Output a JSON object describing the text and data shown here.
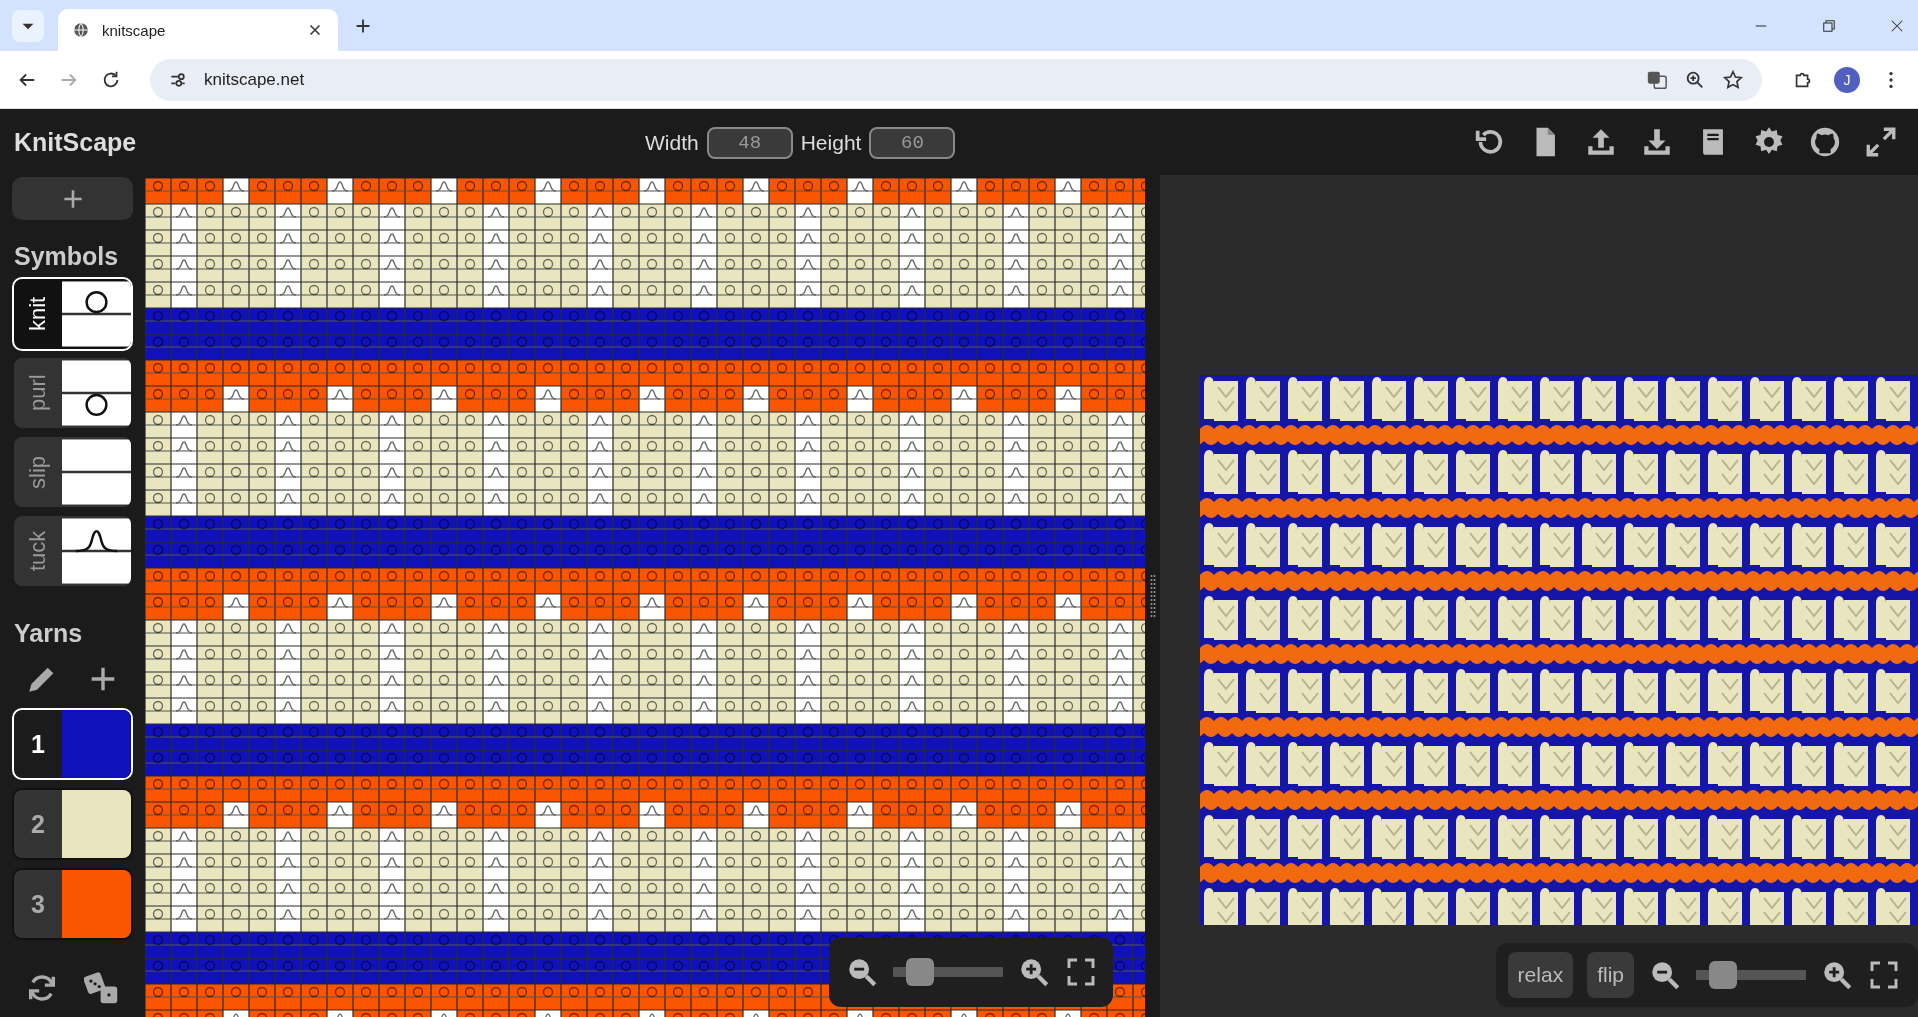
{
  "browser": {
    "tab_title": "knitscape",
    "url": "knitscape.net",
    "profile_initial": "J"
  },
  "header": {
    "title": "KnitScape",
    "width_label": "Width",
    "width_value": "48",
    "height_label": "Height",
    "height_value": "60"
  },
  "symbols_heading": "Symbols",
  "symbols": [
    {
      "label": "knit",
      "kind": "knit",
      "selected": true
    },
    {
      "label": "purl",
      "kind": "purl",
      "selected": false
    },
    {
      "label": "slip",
      "kind": "slip",
      "selected": false
    },
    {
      "label": "tuck",
      "kind": "tuck",
      "selected": false
    }
  ],
  "yarns_heading": "Yarns",
  "yarns": [
    {
      "label": "1",
      "color": "#1111bb",
      "selected": true
    },
    {
      "label": "2",
      "color": "#e9e6bf",
      "selected": false
    },
    {
      "label": "3",
      "color": "#fa5500",
      "selected": false
    }
  ],
  "chart": {
    "repeat_rows": [
      {
        "color": "#fa5500",
        "stitches": [
          {
            "kind": "knit"
          },
          {
            "kind": "knit"
          },
          {
            "kind": "knit"
          },
          {
            "kind": "tuck"
          }
        ]
      },
      {
        "color": "#e9e6bf",
        "stitches": [
          {
            "kind": "knit"
          },
          {
            "kind": "tuck"
          },
          {
            "kind": "knit"
          },
          {
            "kind": "knit"
          }
        ]
      },
      {
        "color": "#e9e6bf",
        "stitches": [
          {
            "kind": "knit"
          },
          {
            "kind": "tuck"
          },
          {
            "kind": "knit"
          },
          {
            "kind": "knit"
          }
        ]
      },
      {
        "color": "#e9e6bf",
        "stitches": [
          {
            "kind": "knit"
          },
          {
            "kind": "tuck"
          },
          {
            "kind": "knit"
          },
          {
            "kind": "knit"
          }
        ]
      },
      {
        "color": "#e9e6bf",
        "stitches": [
          {
            "kind": "knit"
          },
          {
            "kind": "tuck"
          },
          {
            "kind": "knit"
          },
          {
            "kind": "knit"
          }
        ]
      },
      {
        "color": "#1111bb",
        "stitches": [
          {
            "kind": "knit"
          },
          {
            "kind": "knit"
          },
          {
            "kind": "knit"
          },
          {
            "kind": "knit"
          }
        ]
      },
      {
        "color": "#1111bb",
        "stitches": [
          {
            "kind": "knit"
          },
          {
            "kind": "knit"
          },
          {
            "kind": "knit"
          },
          {
            "kind": "knit"
          }
        ]
      },
      {
        "color": "#fa5500",
        "stitches": [
          {
            "kind": "knit"
          },
          {
            "kind": "knit"
          },
          {
            "kind": "knit"
          },
          {
            "kind": "knit"
          }
        ]
      }
    ],
    "zoom": {
      "level": 0.15
    }
  },
  "simulation": {
    "buttons": [
      "relax",
      "flip"
    ],
    "zoom": {
      "level": 0.15
    }
  }
}
